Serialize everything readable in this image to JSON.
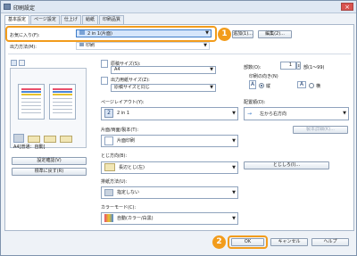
{
  "window": {
    "title": "印刷設定",
    "close_label": "×"
  },
  "tabs": [
    "基本設定",
    "ページ設定",
    "仕上げ",
    "給紙",
    "印刷品質"
  ],
  "favorites": {
    "label": "お気に入り(F):",
    "value": "2 in 1(片面)",
    "add_label": "追加(1)...",
    "edit_label": "編集(2)..."
  },
  "output": {
    "label": "出力方法(M):",
    "value": "印刷"
  },
  "preview": {
    "caption": "A4[普通：自動]"
  },
  "left_buttons": {
    "settings_check": "設定確認(V)",
    "restore_default": "標準に戻す(R)"
  },
  "paper": {
    "original_size_label": "原稿サイズ(S):",
    "original_size_value": "A4",
    "output_size_label": "出力用紙サイズ(Z):",
    "output_size_value": "原稿サイズと同じ"
  },
  "page_layout": {
    "label": "ページレイアウト(Y):",
    "value": "2 in 1"
  },
  "duplex": {
    "label": "片面/両面/製本(T):",
    "value": "片面印刷"
  },
  "binding": {
    "label": "とじ方向(B):",
    "value": "長辺とじ(左)"
  },
  "paper_source": {
    "label": "排紙方法(U):",
    "value": "指定しない"
  },
  "color_mode": {
    "label": "カラーモード(C):",
    "value": "自動(カラー/白黒)"
  },
  "copies": {
    "label": "部数(O):",
    "value": "1",
    "range": "部(1〜99)"
  },
  "orientation": {
    "label": "印刷の向き(N)",
    "portrait_mark": "A",
    "portrait": "縦",
    "landscape_mark": "A",
    "landscape": "横"
  },
  "page_order": {
    "label": "配置順(D):",
    "value": "左から右方向",
    "detail_label": "製本詳細(K)..."
  },
  "binding_settings_label": "とじしろ(I)...",
  "footer": {
    "ok": "OK",
    "cancel": "キャンセル",
    "help": "ヘルプ"
  },
  "badges": {
    "one": "1",
    "two": "2"
  },
  "colors": {
    "accent": "#f29c1c",
    "frame": "#7f93ad",
    "select_blue": "#3d7cc9"
  }
}
